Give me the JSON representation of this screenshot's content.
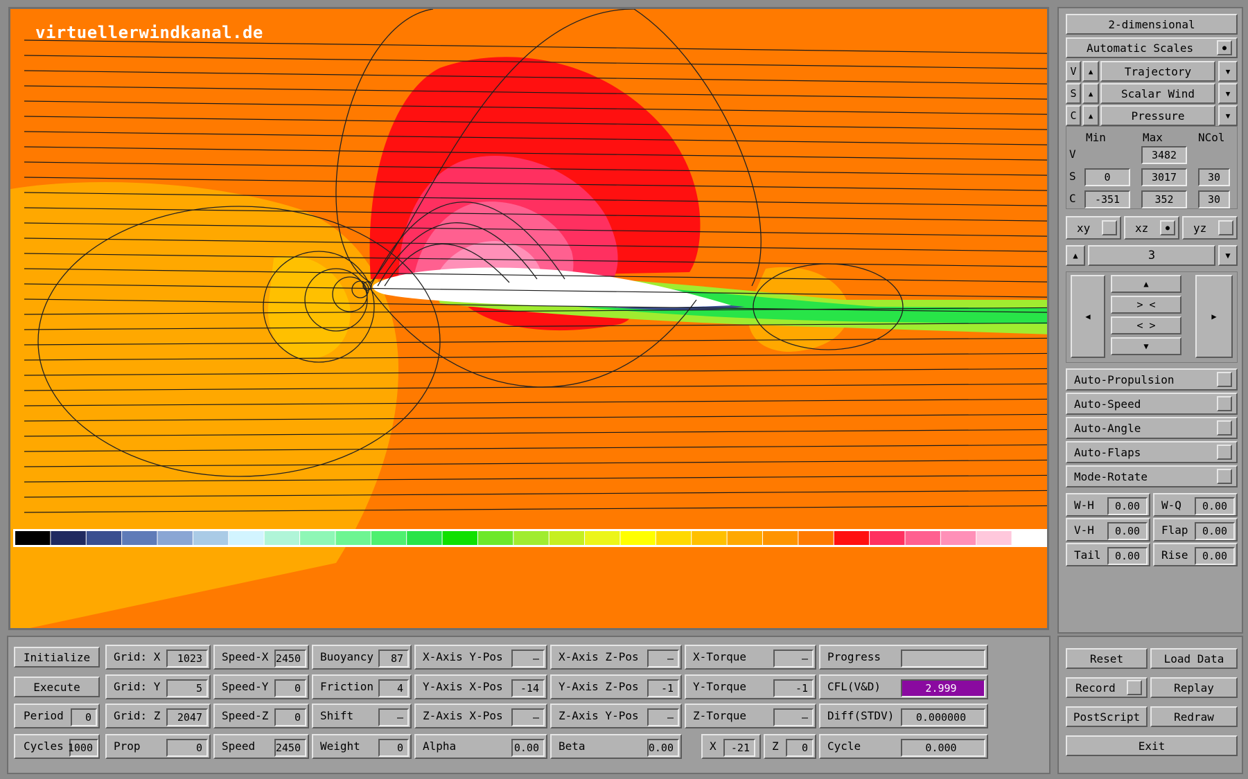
{
  "viewport": {
    "watermark": "virtuellerwindkanal.de",
    "colorbar": [
      "#000000",
      "#202a60",
      "#3a4f90",
      "#5f7bb8",
      "#8aa6d4",
      "#aacbe6",
      "#d2f4ff",
      "#b0f5d8",
      "#8ef7b6",
      "#6ef592",
      "#4ef070",
      "#28e448",
      "#10e000",
      "#6ee82a",
      "#a0ec30",
      "#c6ef20",
      "#ecf51a",
      "#ffff00",
      "#ffd900",
      "#ffc000",
      "#ffa800",
      "#ff9400",
      "#ff7a00",
      "#ff1010",
      "#ff3060",
      "#ff6090",
      "#ff90b8",
      "#ffc8dc",
      "#ffffff"
    ]
  },
  "right_panel": {
    "dimension_btn": "2-dimensional",
    "auto_scales": "Automatic Scales",
    "selectors": [
      {
        "key": "V",
        "value": "Trajectory"
      },
      {
        "key": "S",
        "value": "Scalar Wind"
      },
      {
        "key": "C",
        "value": "Pressure"
      }
    ],
    "scale_headers": [
      "Min",
      "Max",
      "NCol"
    ],
    "scales": [
      {
        "key": "V",
        "min": "",
        "max": "3482",
        "ncol": ""
      },
      {
        "key": "S",
        "min": "0",
        "max": "3017",
        "ncol": "30"
      },
      {
        "key": "C",
        "min": "-351",
        "max": "352",
        "ncol": "30"
      }
    ],
    "planes": [
      "xy",
      "xz",
      "yz"
    ],
    "slice_value": "3",
    "nav_mid": [
      "> <",
      "< >"
    ],
    "toggles": [
      "Auto-Propulsion",
      "Auto-Speed",
      "Auto-Angle",
      "Auto-Flaps",
      "Mode-Rotate"
    ],
    "params": [
      {
        "label": "W-H",
        "value": "0.00"
      },
      {
        "label": "W-Q",
        "value": "0.00"
      },
      {
        "label": "V-H",
        "value": "0.00"
      },
      {
        "label": "Flap",
        "value": "0.00"
      },
      {
        "label": "Tail",
        "value": "0.00"
      },
      {
        "label": "Rise",
        "value": "0.00"
      }
    ]
  },
  "bottom": {
    "initialize": "Initialize",
    "execute": "Execute",
    "period": {
      "label": "Period",
      "value": "0"
    },
    "cycles": {
      "label": "Cycles",
      "value": "1000"
    },
    "col2": [
      {
        "label": "Grid: X",
        "value": "1023"
      },
      {
        "label": "Grid: Y",
        "value": "5"
      },
      {
        "label": "Grid: Z",
        "value": "2047"
      },
      {
        "label": "Prop",
        "value": "0"
      }
    ],
    "col3": [
      {
        "label": "Speed-X",
        "value": "2450"
      },
      {
        "label": "Speed-Y",
        "value": "0"
      },
      {
        "label": "Speed-Z",
        "value": "0"
      },
      {
        "label": "Speed",
        "value": "2450"
      }
    ],
    "col4": [
      {
        "label": "Buoyancy",
        "value": "87"
      },
      {
        "label": "Friction",
        "value": "4"
      },
      {
        "label": "Shift",
        "value": "—"
      },
      {
        "label": "Weight",
        "value": "0"
      }
    ],
    "col5": [
      {
        "label": "X-Axis Y-Pos",
        "value": "—"
      },
      {
        "label": "Y-Axis X-Pos",
        "value": "-14"
      },
      {
        "label": "Z-Axis X-Pos",
        "value": "—"
      },
      {
        "label": "Alpha",
        "value": "0.00"
      }
    ],
    "col6": [
      {
        "label": "X-Axis Z-Pos",
        "value": "—"
      },
      {
        "label": "Y-Axis Z-Pos",
        "value": "-1"
      },
      {
        "label": "Z-Axis Y-Pos",
        "value": "—"
      },
      {
        "label": "Beta",
        "value": "0.00"
      }
    ],
    "col7": [
      {
        "label": "X-Torque",
        "value": "—"
      },
      {
        "label": "Y-Torque",
        "value": "-1"
      },
      {
        "label": "Z-Torque",
        "value": "—"
      }
    ],
    "col7_xz": {
      "x_label": "X",
      "x_value": "-21",
      "z_label": "Z",
      "z_value": "0"
    },
    "col8": [
      {
        "label": "Progress",
        "value": ""
      },
      {
        "label": "CFL(V&D)",
        "value": "2.999"
      },
      {
        "label": "Diff(STDV)",
        "value": "0.000000"
      },
      {
        "label": "Cycle",
        "value": "0.000"
      }
    ],
    "cfl_color": "#8a0aa0",
    "buttons": {
      "reset": "Reset",
      "load": "Load Data",
      "record": "Record",
      "replay": "Replay",
      "postscript": "PostScript",
      "redraw": "Redraw",
      "exit": "Exit"
    }
  }
}
